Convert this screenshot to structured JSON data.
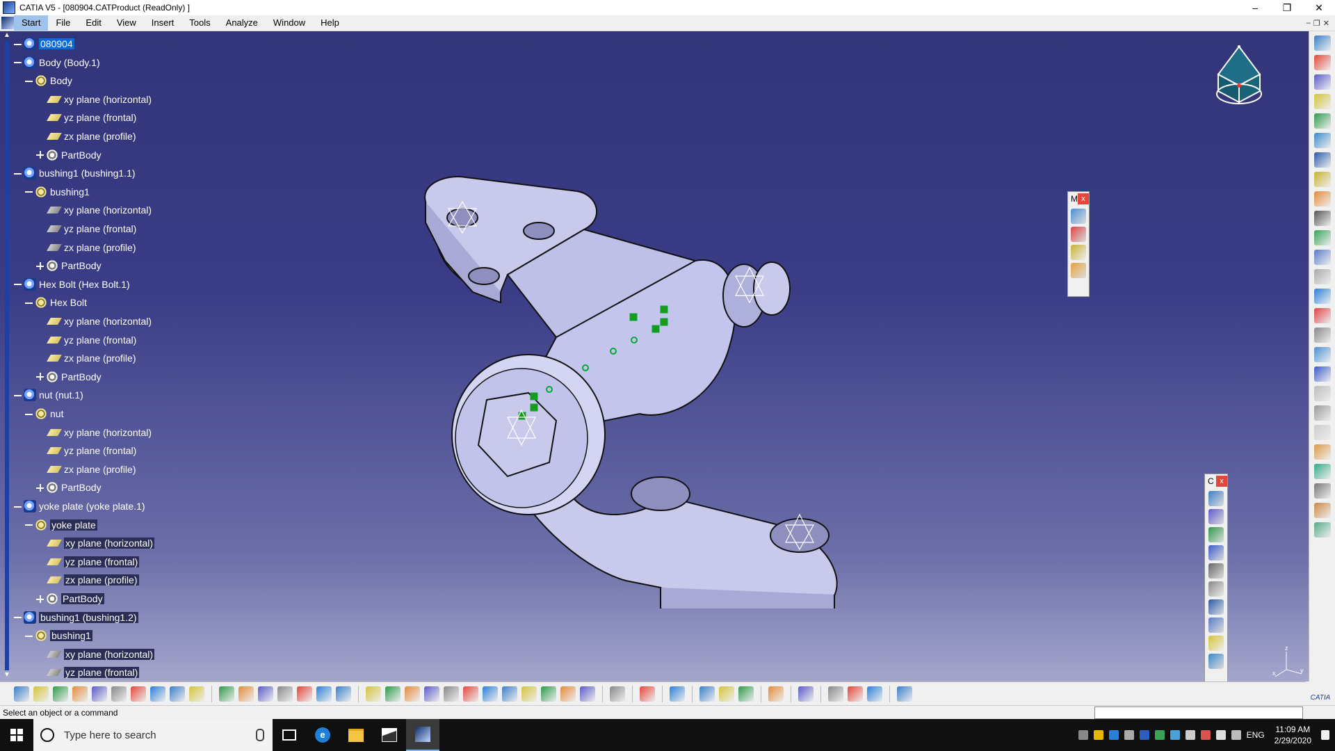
{
  "window": {
    "title": "CATIA V5 - [080904.CATProduct (ReadOnly) ]",
    "minimize": "–",
    "maximize": "❐",
    "close": "✕"
  },
  "menu": [
    "Start",
    "File",
    "Edit",
    "View",
    "Insert",
    "Tools",
    "Analyze",
    "Window",
    "Help"
  ],
  "tree": {
    "root": "080904",
    "nodes": [
      {
        "label": "Body (Body.1)",
        "type": "prod",
        "level": 1,
        "style": ""
      },
      {
        "label": "Body",
        "type": "gear",
        "level": 2,
        "style": ""
      },
      {
        "label": "xy plane (horizontal)",
        "type": "plane",
        "level": 3,
        "style": ""
      },
      {
        "label": "yz plane (frontal)",
        "type": "plane",
        "level": 3,
        "style": ""
      },
      {
        "label": "zx plane (profile)",
        "type": "plane",
        "level": 3,
        "style": ""
      },
      {
        "label": "PartBody",
        "type": "pb",
        "level": 3,
        "style": ""
      },
      {
        "label": "bushing1 (bushing1.1)",
        "type": "prod",
        "level": 1,
        "style": ""
      },
      {
        "label": "bushing1",
        "type": "gear",
        "level": 2,
        "style": ""
      },
      {
        "label": "xy plane (horizontal)",
        "type": "plane-grey",
        "level": 3,
        "style": ""
      },
      {
        "label": "yz plane (frontal)",
        "type": "plane-grey",
        "level": 3,
        "style": ""
      },
      {
        "label": "zx plane (profile)",
        "type": "plane-grey",
        "level": 3,
        "style": ""
      },
      {
        "label": "PartBody",
        "type": "pb",
        "level": 3,
        "style": ""
      },
      {
        "label": "Hex Bolt (Hex Bolt.1)",
        "type": "prod",
        "level": 1,
        "style": ""
      },
      {
        "label": "Hex Bolt",
        "type": "gear",
        "level": 2,
        "style": ""
      },
      {
        "label": "xy plane (horizontal)",
        "type": "plane",
        "level": 3,
        "style": ""
      },
      {
        "label": "yz plane (frontal)",
        "type": "plane",
        "level": 3,
        "style": ""
      },
      {
        "label": "zx plane (profile)",
        "type": "plane",
        "level": 3,
        "style": ""
      },
      {
        "label": "PartBody",
        "type": "pb",
        "level": 3,
        "style": ""
      },
      {
        "label": "nut (nut.1)",
        "type": "prod",
        "level": 1,
        "style": ""
      },
      {
        "label": "nut",
        "type": "gear",
        "level": 2,
        "style": ""
      },
      {
        "label": "xy plane (horizontal)",
        "type": "plane",
        "level": 3,
        "style": ""
      },
      {
        "label": "yz plane (frontal)",
        "type": "plane",
        "level": 3,
        "style": ""
      },
      {
        "label": "zx plane (profile)",
        "type": "plane",
        "level": 3,
        "style": ""
      },
      {
        "label": "PartBody",
        "type": "pb",
        "level": 3,
        "style": ""
      },
      {
        "label": "yoke plate (yoke plate.1)",
        "type": "prod",
        "level": 1,
        "style": ""
      },
      {
        "label": "yoke plate",
        "type": "gear",
        "level": 2,
        "style": "sel"
      },
      {
        "label": "xy plane (horizontal)",
        "type": "plane",
        "level": 3,
        "style": "sel"
      },
      {
        "label": "yz plane (frontal)",
        "type": "plane",
        "level": 3,
        "style": "sel"
      },
      {
        "label": "zx plane (profile)",
        "type": "plane",
        "level": 3,
        "style": "sel"
      },
      {
        "label": "PartBody",
        "type": "pb",
        "level": 3,
        "style": "sel"
      },
      {
        "label": "bushing1 (bushing1.2)",
        "type": "prod",
        "level": 1,
        "style": "sel"
      },
      {
        "label": "bushing1",
        "type": "gear",
        "level": 2,
        "style": "sel"
      },
      {
        "label": "xy plane (horizontal)",
        "type": "plane-grey",
        "level": 3,
        "style": "sel"
      },
      {
        "label": "yz plane (frontal)",
        "type": "plane-grey",
        "level": 3,
        "style": "sel"
      }
    ]
  },
  "floating_toolbar_1": {
    "title": "M",
    "close": "x"
  },
  "floating_toolbar_2": {
    "title": "C",
    "close": "x"
  },
  "status": {
    "message": "Select an object or a command"
  },
  "taskbar": {
    "search_placeholder": "Type here to search",
    "lang": "ENG",
    "time": "11:09 AM",
    "date": "2/29/2020"
  },
  "catia_mark": "CATIA",
  "axis_labels": {
    "x": "x",
    "y": "y",
    "z": "z"
  },
  "colors": {
    "viewport_top": "#33357a",
    "viewport_bottom": "#a4a6cc",
    "selection": "#0a6ad6",
    "model_face": "#c9c9ec"
  }
}
